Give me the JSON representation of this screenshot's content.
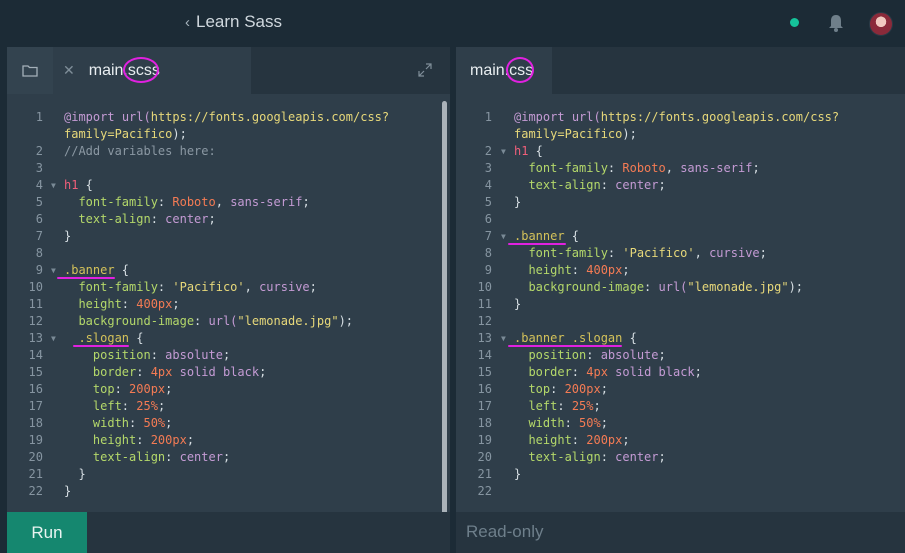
{
  "app": {
    "back_label": "Learn Sass"
  },
  "left": {
    "filename": "main.scss",
    "lines": [
      {
        "n": "1",
        "fold": "",
        "segs": [
          [
            "@import",
            "at"
          ],
          [
            " ",
            "plain"
          ],
          [
            "url(",
            "fn"
          ],
          [
            "https://fonts.googleapis.com/css?",
            "url"
          ]
        ]
      },
      {
        "n": "",
        "fold": "",
        "segs": [
          [
            "family=Pacifico",
            "url"
          ],
          [
            ");",
            "plain"
          ]
        ]
      },
      {
        "n": "2",
        "fold": "",
        "segs": [
          [
            "//Add variables here:",
            "com"
          ]
        ]
      },
      {
        "n": "3",
        "fold": "",
        "segs": []
      },
      {
        "n": "4",
        "fold": "▼",
        "segs": [
          [
            "h1",
            "tag"
          ],
          [
            " {",
            "plain"
          ]
        ]
      },
      {
        "n": "5",
        "fold": "",
        "segs": [
          [
            "  font-family",
            "prop"
          ],
          [
            ": ",
            "plain"
          ],
          [
            "Roboto",
            "num"
          ],
          [
            ", ",
            "plain"
          ],
          [
            "sans-serif",
            "kw"
          ],
          [
            ";",
            "plain"
          ]
        ]
      },
      {
        "n": "6",
        "fold": "",
        "segs": [
          [
            "  text-align",
            "prop"
          ],
          [
            ": ",
            "plain"
          ],
          [
            "center",
            "kw"
          ],
          [
            ";",
            "plain"
          ]
        ]
      },
      {
        "n": "7",
        "fold": "",
        "segs": [
          [
            "}",
            "plain"
          ]
        ]
      },
      {
        "n": "8",
        "fold": "",
        "segs": []
      },
      {
        "n": "9",
        "fold": "▼",
        "segs": [
          [
            ".banner",
            "cls"
          ],
          [
            " {",
            "plain"
          ]
        ]
      },
      {
        "n": "10",
        "fold": "",
        "segs": [
          [
            "  font-family",
            "prop"
          ],
          [
            ": ",
            "plain"
          ],
          [
            "'Pacifico'",
            "str"
          ],
          [
            ", ",
            "plain"
          ],
          [
            "cursive",
            "kw"
          ],
          [
            ";",
            "plain"
          ]
        ]
      },
      {
        "n": "11",
        "fold": "",
        "segs": [
          [
            "  height",
            "prop"
          ],
          [
            ": ",
            "plain"
          ],
          [
            "400px",
            "num"
          ],
          [
            ";",
            "plain"
          ]
        ]
      },
      {
        "n": "12",
        "fold": "",
        "segs": [
          [
            "  background-image",
            "prop"
          ],
          [
            ": ",
            "plain"
          ],
          [
            "url(",
            "fn"
          ],
          [
            "\"lemonade.jpg\"",
            "str"
          ],
          [
            ");",
            "plain"
          ]
        ]
      },
      {
        "n": "13",
        "fold": "▼",
        "segs": [
          [
            "  .slogan",
            "cls"
          ],
          [
            " {",
            "plain"
          ]
        ]
      },
      {
        "n": "14",
        "fold": "",
        "segs": [
          [
            "    position",
            "prop"
          ],
          [
            ": ",
            "plain"
          ],
          [
            "absolute",
            "kw"
          ],
          [
            ";",
            "plain"
          ]
        ]
      },
      {
        "n": "15",
        "fold": "",
        "segs": [
          [
            "    border",
            "prop"
          ],
          [
            ": ",
            "plain"
          ],
          [
            "4px",
            "num"
          ],
          [
            " ",
            "plain"
          ],
          [
            "solid",
            "kw"
          ],
          [
            " ",
            "plain"
          ],
          [
            "black",
            "kw"
          ],
          [
            ";",
            "plain"
          ]
        ]
      },
      {
        "n": "16",
        "fold": "",
        "segs": [
          [
            "    top",
            "prop"
          ],
          [
            ": ",
            "plain"
          ],
          [
            "200px",
            "num"
          ],
          [
            ";",
            "plain"
          ]
        ]
      },
      {
        "n": "17",
        "fold": "",
        "segs": [
          [
            "    left",
            "prop"
          ],
          [
            ": ",
            "plain"
          ],
          [
            "25%",
            "num"
          ],
          [
            ";",
            "plain"
          ]
        ]
      },
      {
        "n": "18",
        "fold": "",
        "segs": [
          [
            "    width",
            "prop"
          ],
          [
            ": ",
            "plain"
          ],
          [
            "50%",
            "num"
          ],
          [
            ";",
            "plain"
          ]
        ]
      },
      {
        "n": "19",
        "fold": "",
        "segs": [
          [
            "    height",
            "prop"
          ],
          [
            ": ",
            "plain"
          ],
          [
            "200px",
            "num"
          ],
          [
            ";",
            "plain"
          ]
        ]
      },
      {
        "n": "20",
        "fold": "",
        "segs": [
          [
            "    text-align",
            "prop"
          ],
          [
            ": ",
            "plain"
          ],
          [
            "center",
            "kw"
          ],
          [
            ";",
            "plain"
          ]
        ]
      },
      {
        "n": "21",
        "fold": "",
        "segs": [
          [
            "  }",
            "plain"
          ]
        ]
      },
      {
        "n": "22",
        "fold": "",
        "segs": [
          [
            "}",
            "plain"
          ]
        ]
      }
    ],
    "run_label": "Run"
  },
  "right": {
    "filename": "main.css",
    "lines": [
      {
        "n": "1",
        "fold": "",
        "segs": [
          [
            "@import",
            "at"
          ],
          [
            " ",
            "plain"
          ],
          [
            "url(",
            "fn"
          ],
          [
            "https://fonts.googleapis.com/css?",
            "url"
          ]
        ]
      },
      {
        "n": "",
        "fold": "",
        "segs": [
          [
            "family=Pacifico",
            "url"
          ],
          [
            ");",
            "plain"
          ]
        ]
      },
      {
        "n": "2",
        "fold": "▼",
        "segs": [
          [
            "h1",
            "tag"
          ],
          [
            " {",
            "plain"
          ]
        ]
      },
      {
        "n": "3",
        "fold": "",
        "segs": [
          [
            "  font-family",
            "prop"
          ],
          [
            ": ",
            "plain"
          ],
          [
            "Roboto",
            "num"
          ],
          [
            ", ",
            "plain"
          ],
          [
            "sans-serif",
            "kw"
          ],
          [
            ";",
            "plain"
          ]
        ]
      },
      {
        "n": "4",
        "fold": "",
        "segs": [
          [
            "  text-align",
            "prop"
          ],
          [
            ": ",
            "plain"
          ],
          [
            "center",
            "kw"
          ],
          [
            ";",
            "plain"
          ]
        ]
      },
      {
        "n": "5",
        "fold": "",
        "segs": [
          [
            "}",
            "plain"
          ]
        ]
      },
      {
        "n": "6",
        "fold": "",
        "segs": []
      },
      {
        "n": "7",
        "fold": "▼",
        "segs": [
          [
            ".banner",
            "cls"
          ],
          [
            " {",
            "plain"
          ]
        ]
      },
      {
        "n": "8",
        "fold": "",
        "segs": [
          [
            "  font-family",
            "prop"
          ],
          [
            ": ",
            "plain"
          ],
          [
            "'Pacifico'",
            "str"
          ],
          [
            ", ",
            "plain"
          ],
          [
            "cursive",
            "kw"
          ],
          [
            ";",
            "plain"
          ]
        ]
      },
      {
        "n": "9",
        "fold": "",
        "segs": [
          [
            "  height",
            "prop"
          ],
          [
            ": ",
            "plain"
          ],
          [
            "400px",
            "num"
          ],
          [
            ";",
            "plain"
          ]
        ]
      },
      {
        "n": "10",
        "fold": "",
        "segs": [
          [
            "  background-image",
            "prop"
          ],
          [
            ": ",
            "plain"
          ],
          [
            "url(",
            "fn"
          ],
          [
            "\"lemonade.jpg\"",
            "str"
          ],
          [
            ");",
            "plain"
          ]
        ]
      },
      {
        "n": "11",
        "fold": "",
        "segs": [
          [
            "}",
            "plain"
          ]
        ]
      },
      {
        "n": "12",
        "fold": "",
        "segs": []
      },
      {
        "n": "13",
        "fold": "▼",
        "segs": [
          [
            ".banner .slogan",
            "cls"
          ],
          [
            " {",
            "plain"
          ]
        ]
      },
      {
        "n": "14",
        "fold": "",
        "segs": [
          [
            "  position",
            "prop"
          ],
          [
            ": ",
            "plain"
          ],
          [
            "absolute",
            "kw"
          ],
          [
            ";",
            "plain"
          ]
        ]
      },
      {
        "n": "15",
        "fold": "",
        "segs": [
          [
            "  border",
            "prop"
          ],
          [
            ": ",
            "plain"
          ],
          [
            "4px",
            "num"
          ],
          [
            " ",
            "plain"
          ],
          [
            "solid",
            "kw"
          ],
          [
            " ",
            "plain"
          ],
          [
            "black",
            "kw"
          ],
          [
            ";",
            "plain"
          ]
        ]
      },
      {
        "n": "16",
        "fold": "",
        "segs": [
          [
            "  top",
            "prop"
          ],
          [
            ": ",
            "plain"
          ],
          [
            "200px",
            "num"
          ],
          [
            ";",
            "plain"
          ]
        ]
      },
      {
        "n": "17",
        "fold": "",
        "segs": [
          [
            "  left",
            "prop"
          ],
          [
            ": ",
            "plain"
          ],
          [
            "25%",
            "num"
          ],
          [
            ";",
            "plain"
          ]
        ]
      },
      {
        "n": "18",
        "fold": "",
        "segs": [
          [
            "  width",
            "prop"
          ],
          [
            ": ",
            "plain"
          ],
          [
            "50%",
            "num"
          ],
          [
            ";",
            "plain"
          ]
        ]
      },
      {
        "n": "19",
        "fold": "",
        "segs": [
          [
            "  height",
            "prop"
          ],
          [
            ": ",
            "plain"
          ],
          [
            "200px",
            "num"
          ],
          [
            ";",
            "plain"
          ]
        ]
      },
      {
        "n": "20",
        "fold": "",
        "segs": [
          [
            "  text-align",
            "prop"
          ],
          [
            ": ",
            "plain"
          ],
          [
            "center",
            "kw"
          ],
          [
            ";",
            "plain"
          ]
        ]
      },
      {
        "n": "21",
        "fold": "",
        "segs": [
          [
            "}",
            "plain"
          ]
        ]
      },
      {
        "n": "22",
        "fold": "",
        "segs": []
      }
    ],
    "readonly_label": "Read-only"
  },
  "icons": {
    "back": "chevron-left-icon",
    "status": "status-dot-icon",
    "bell": "bell-icon",
    "avatar": "avatar",
    "folder": "folder-icon",
    "close": "close-icon",
    "expand": "expand-icon"
  },
  "colors": {
    "accent": "#15876f",
    "annotation": "#e021e0"
  }
}
